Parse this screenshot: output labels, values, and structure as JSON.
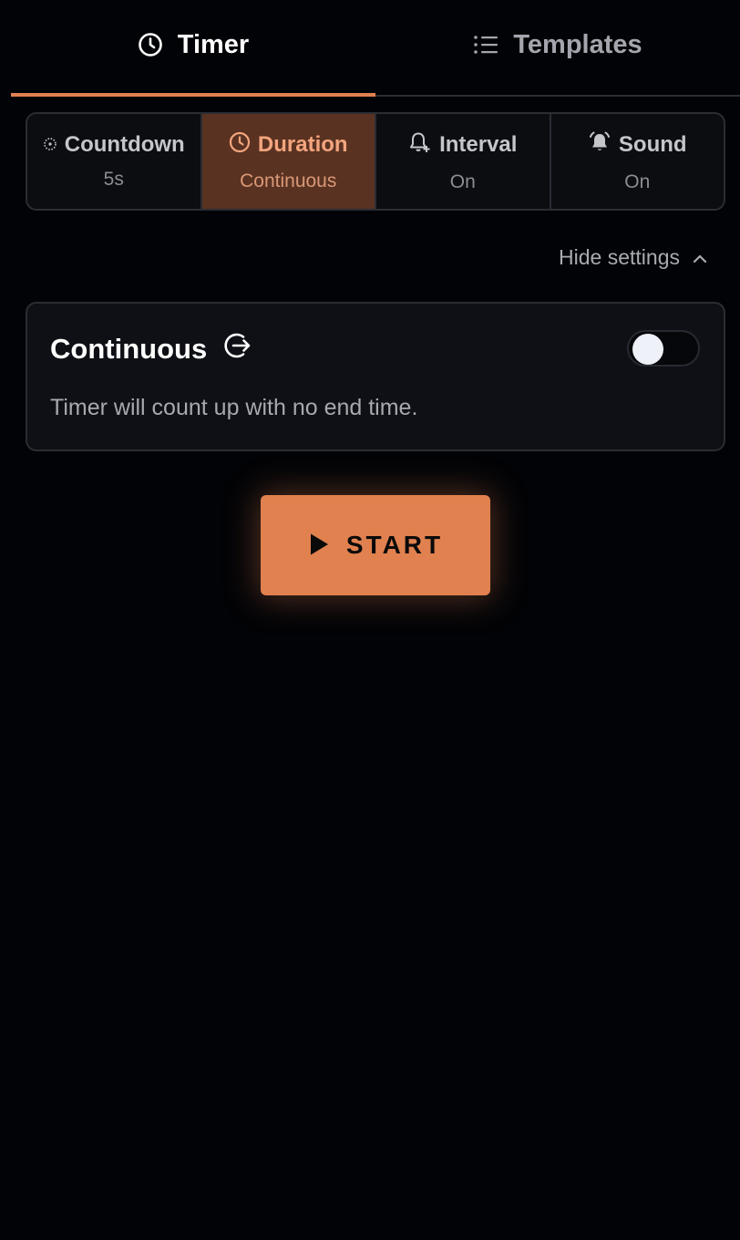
{
  "tabs": [
    {
      "label": "Timer",
      "icon": "clock-icon",
      "active": true
    },
    {
      "label": "Templates",
      "icon": "list-icon",
      "active": false
    }
  ],
  "modes": [
    {
      "label": "Countdown",
      "value": "5s",
      "icon": "dotted-circle-icon",
      "selected": false
    },
    {
      "label": "Duration",
      "value": "Continuous",
      "icon": "clock-icon",
      "selected": true
    },
    {
      "label": "Interval",
      "value": "On",
      "icon": "bell-plus-icon",
      "selected": false
    },
    {
      "label": "Sound",
      "value": "On",
      "icon": "alarm-bell-icon",
      "selected": false
    }
  ],
  "settings_toggle": {
    "label": "Hide settings",
    "icon": "chevron-up-icon"
  },
  "card": {
    "title": "Continuous",
    "icon": "arrow-right-circle-icon",
    "description": "Timer will count up with no end time.",
    "toggle_on": false
  },
  "start_button": {
    "label": "START",
    "icon": "play-icon"
  },
  "colors": {
    "accent": "#e0814f",
    "background": "#020306",
    "selected_mode_bg": "#5a3222",
    "card_bg": "#0e1015"
  }
}
